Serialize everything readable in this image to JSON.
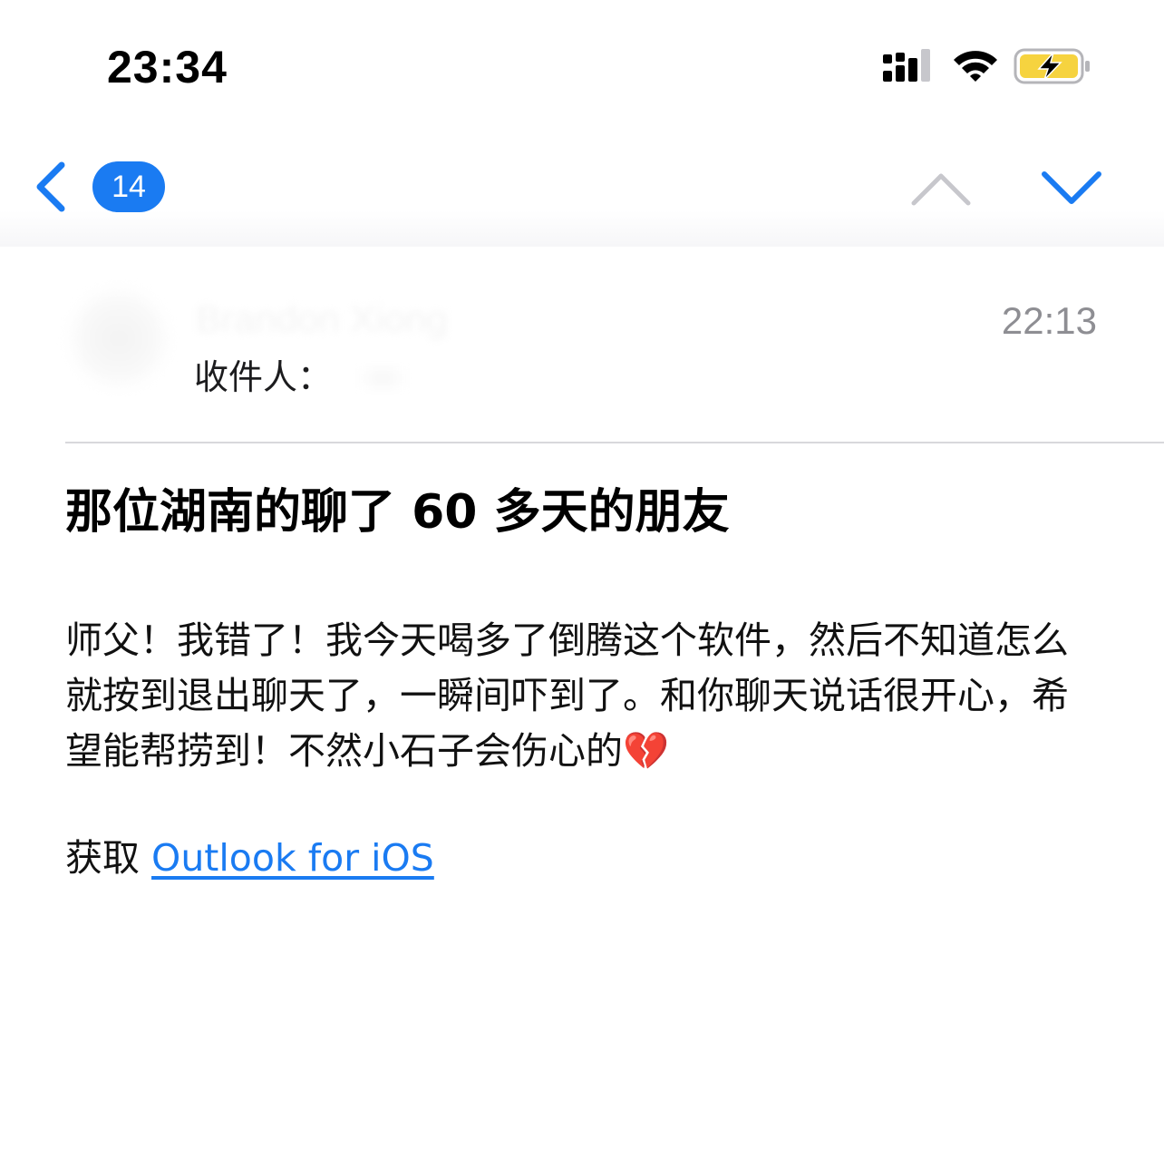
{
  "status_bar": {
    "time": "23:34",
    "signal_icon": "cellular-signal-icon",
    "wifi_icon": "wifi-icon",
    "battery_icon": "battery-charging-icon",
    "battery_color": "#f6d33f"
  },
  "nav": {
    "back_icon": "chevron-left-icon",
    "unread_count": "14",
    "prev_icon": "chevron-up-icon",
    "next_icon": "chevron-down-icon",
    "accent_color": "#1a7bf2"
  },
  "message": {
    "sender_name": "Brandon Xiong",
    "received_time": "22:13",
    "to_label": "收件人：",
    "subject": "那位湖南的聊了 60 多天的朋友",
    "body": "师父！我错了！我今天喝多了倒腾这个软件，然后不知道怎么就按到退出聊天了，一瞬间吓到了。和你聊天说话很开心，希望能帮捞到！不然小石子会伤心的💔",
    "signature_prefix": "获取",
    "signature_link": "Outlook for iOS"
  }
}
